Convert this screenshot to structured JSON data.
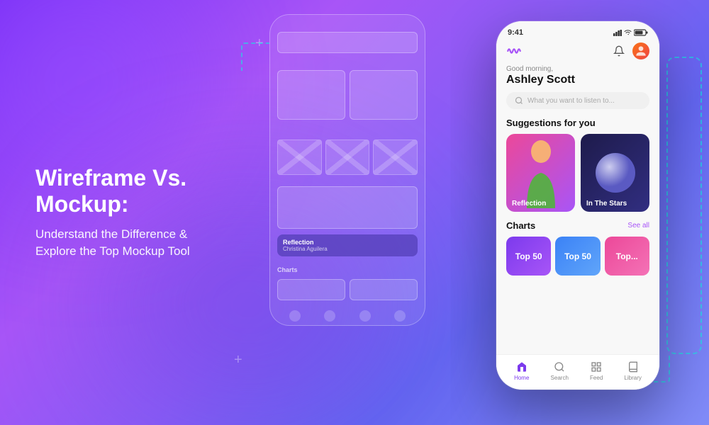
{
  "background": {
    "gradient_start": "#7b2ff7",
    "gradient_end": "#818cf8"
  },
  "text_section": {
    "main_title": "Wireframe Vs. Mockup:",
    "sub_title_line1": "Understand the Difference &",
    "sub_title_line2": "Explore the Top Mockup Tool"
  },
  "wireframe_phone": {
    "visible": true
  },
  "mockup_phone": {
    "status_bar": {
      "time": "9:41",
      "signal": "●●●",
      "wifi": "wifi",
      "battery": "battery"
    },
    "header": {
      "logo_alt": "music wave logo",
      "bell_icon": "bell",
      "avatar_alt": "user avatar"
    },
    "greeting": "Good morning,",
    "user_name": "Ashley Scott",
    "search_placeholder": "What you want to listen to...",
    "suggestions_section": {
      "title": "Suggestions for you",
      "cards": [
        {
          "label": "Reflection",
          "color_class": "card-purple"
        },
        {
          "label": "In The Stars",
          "color_class": "card-dark"
        }
      ]
    },
    "charts_section": {
      "title": "Charts",
      "see_all": "See all",
      "cards": [
        {
          "label": "Top 50",
          "color_class": "chart-purple"
        },
        {
          "label": "Top 50",
          "color_class": "chart-blue"
        },
        {
          "label": "Top...",
          "color_class": "chart-pink"
        }
      ]
    },
    "bottom_nav": {
      "items": [
        {
          "label": "Home",
          "icon": "home",
          "active": true
        },
        {
          "label": "Search",
          "icon": "search",
          "active": false
        },
        {
          "label": "Feed",
          "icon": "feed",
          "active": false
        },
        {
          "label": "Library",
          "icon": "library",
          "active": false
        }
      ]
    }
  }
}
